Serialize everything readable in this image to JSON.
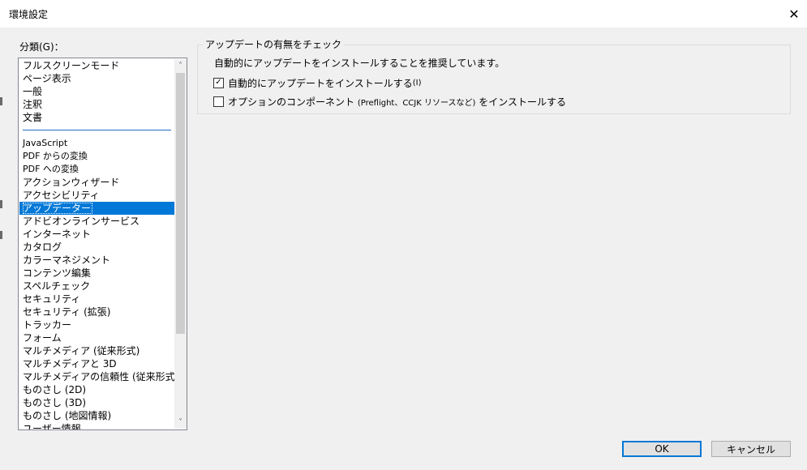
{
  "window": {
    "title": "環境設定",
    "close_glyph": "✕"
  },
  "sidebar": {
    "label": "分類(G)：",
    "items_top": [
      "フルスクリーンモード",
      "ページ表示",
      "一般",
      "注釈",
      "文書"
    ],
    "items_bottom": [
      "JavaScript",
      "PDF からの変換",
      "PDF への変換",
      "アクションウィザード",
      "アクセシビリティ",
      "アップデーター",
      "アドビオンラインサービス",
      "インターネット",
      "カタログ",
      "カラーマネジメント",
      "コンテンツ編集",
      "スペルチェック",
      "セキュリティ",
      "セキュリティ (拡張)",
      "トラッカー",
      "フォーム",
      "マルチメディア (従来形式)",
      "マルチメディアと 3D",
      "マルチメディアの信頼性 (従来形式)",
      "ものさし (2D)",
      "ものさし (3D)",
      "ものさし (地図情報)",
      "ユーザー情報"
    ],
    "selected_item": "アップデーター",
    "scroll_up_glyph": "˄",
    "scroll_down_glyph": "˅"
  },
  "updates": {
    "group_title": "アップデートの有無をチェック",
    "recommend_text": "自動的にアップデートをインストールすることを推奨しています。",
    "auto_install": {
      "label": "自動的にアップデートをインストールする",
      "shortcut": "(I)",
      "checked": true,
      "check_glyph": "✓"
    },
    "optional_components": {
      "label_prefix": "オプションのコンポーネント",
      "label_detail": "(Preflight、CCJK リソースなど)",
      "label_suffix": "をインストールする",
      "checked": false
    }
  },
  "buttons": {
    "ok": "OK",
    "cancel": "キャンセル"
  }
}
